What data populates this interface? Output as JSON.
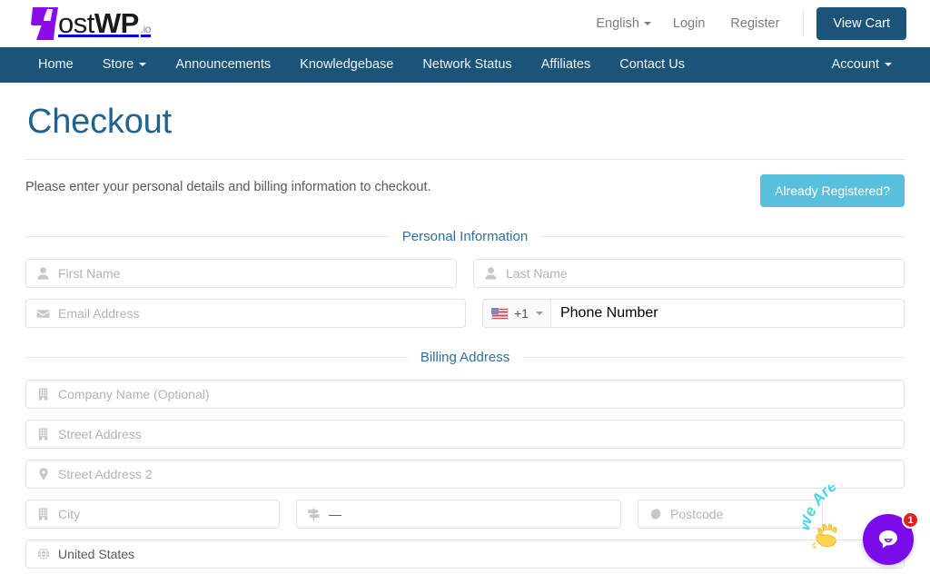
{
  "brand": {
    "name_plain": "ost",
    "name_bold": "WP",
    "tld": ".io",
    "mark_color": "#8a0ce6",
    "nav_color": "#1b5479"
  },
  "topnav": {
    "language": "English",
    "login": "Login",
    "register": "Register",
    "view_cart": "View Cart"
  },
  "mainnav": {
    "items": [
      {
        "label": "Home",
        "caret": false
      },
      {
        "label": "Store",
        "caret": true
      },
      {
        "label": "Announcements",
        "caret": false
      },
      {
        "label": "Knowledgebase",
        "caret": false
      },
      {
        "label": "Network Status",
        "caret": false
      },
      {
        "label": "Affiliates",
        "caret": false
      },
      {
        "label": "Contact Us",
        "caret": false
      }
    ],
    "account": "Account"
  },
  "page": {
    "title": "Checkout",
    "intro": "Please enter your personal details and billing information to checkout.",
    "already_registered": "Already Registered?",
    "accent_title_color": "#20638f",
    "already_registered_color": "#58c0dd"
  },
  "sections": {
    "personal": "Personal Information",
    "billing": "Billing Address"
  },
  "form": {
    "first_name": {
      "placeholder": "First Name",
      "value": "",
      "icon": "user-icon"
    },
    "last_name": {
      "placeholder": "Last Name",
      "value": "",
      "icon": "user-icon"
    },
    "email": {
      "placeholder": "Email Address",
      "value": "",
      "icon": "envelope-icon"
    },
    "phone": {
      "placeholder": "Phone Number",
      "value": "",
      "dial_code": "+1",
      "flag": "us-flag-icon"
    },
    "company": {
      "placeholder": "Company Name (Optional)",
      "value": "",
      "icon": "building-icon"
    },
    "address1": {
      "placeholder": "Street Address",
      "value": "",
      "icon": "building-icon"
    },
    "address2": {
      "placeholder": "Street Address 2",
      "value": "",
      "icon": "map-marker-icon"
    },
    "city": {
      "placeholder": "City",
      "value": "",
      "icon": "building-icon"
    },
    "state": {
      "placeholder": "",
      "value": "—",
      "icon": "map-signs-icon"
    },
    "postcode": {
      "placeholder": "Postcode",
      "value": "",
      "icon": "cog-icon"
    },
    "country": {
      "placeholder": "",
      "value": "United States",
      "icon": "globe-icon"
    }
  },
  "chat": {
    "bubble_text": "We Are Here!",
    "badge_count": "1",
    "button_color": "#7b0cea",
    "badge_color": "#e02020"
  }
}
